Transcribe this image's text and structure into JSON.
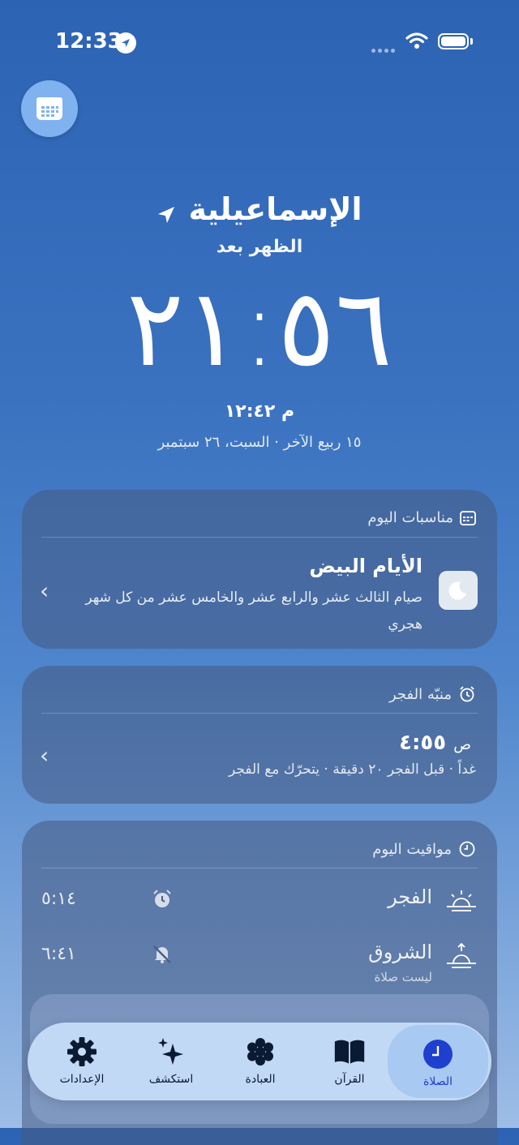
{
  "status_bar": {
    "time": "12:33"
  },
  "header": {
    "city": "الإسماعيلية",
    "next_prayer_label": "الظهر بعد",
    "countdown": "٢١:٥٦",
    "current_time": "١٢:٤٢",
    "current_ampm": "م",
    "date_line": "١٥ ربيع الآخر · السبت، ٢٦ سبتمبر"
  },
  "events_card": {
    "title": "مناسبات اليوم",
    "event_title": "الأيام البيض",
    "event_desc": "صيام الثالث عشر والرابع عشر والخامس عشر من كل شهر هجري"
  },
  "alarm_card": {
    "title": "منبّه الفجر",
    "time": "٤:٥٥",
    "ampm": "ص",
    "desc": "غداً · قبل الفجر ٢٠ دقيقة · يتحرّك مع الفجر"
  },
  "prayers_card": {
    "title": "مواقيت اليوم",
    "rows": [
      {
        "name": "الفجر",
        "sub": "",
        "time": "٥:١٤",
        "bell": "alarm-clock-icon",
        "icon": "sunrise-icon"
      },
      {
        "name": "الشروق",
        "sub": "ليست صلاة",
        "time": "٦:٤١",
        "bell": "bell-slash-icon",
        "icon": "sunrise-up-icon"
      }
    ]
  },
  "tabbar": {
    "tabs": [
      {
        "label": "الإعدادات",
        "icon": "gear-icon"
      },
      {
        "label": "استكشف",
        "icon": "sparkles-icon"
      },
      {
        "label": "العبادة",
        "icon": "flower-icon"
      },
      {
        "label": "القرآن",
        "icon": "book-icon"
      },
      {
        "label": "الصلاة",
        "icon": "clock-icon",
        "active": true
      }
    ]
  },
  "colors": {
    "accent": "#1f3fcf",
    "tab_bg": "#c8def9"
  }
}
